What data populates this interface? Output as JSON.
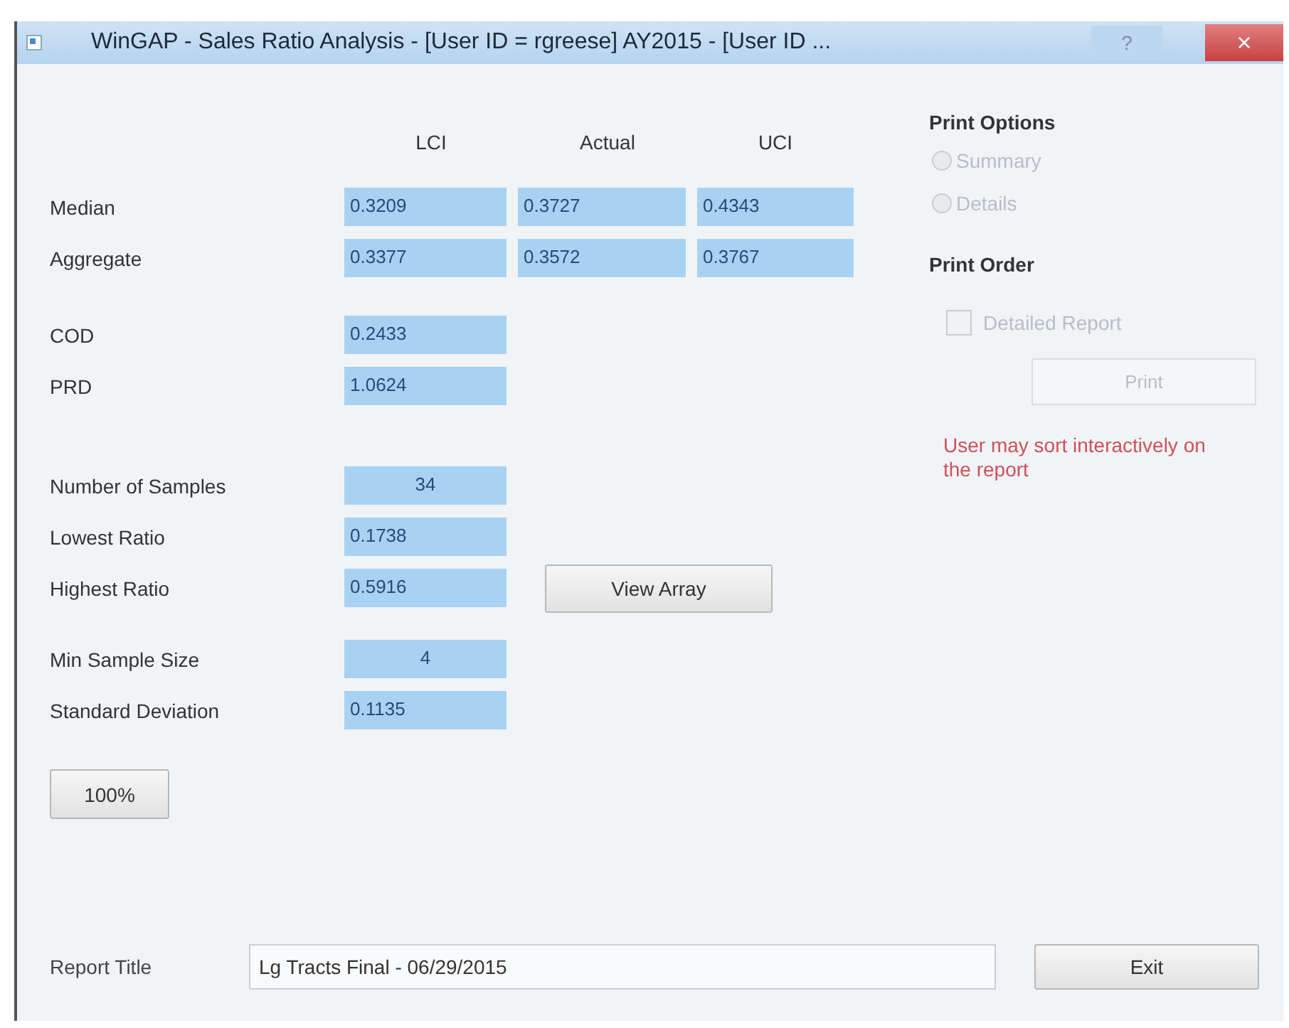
{
  "window": {
    "title": "WinGAP - Sales Ratio Analysis - [User ID = rgreese] AY2015 - [User ID ...",
    "help": "?",
    "close": "×"
  },
  "stats": {
    "columns": [
      "LCI",
      "Actual",
      "UCI"
    ],
    "groups": [
      {
        "rows": [
          {
            "label": "Median",
            "values": [
              "0.3209",
              "0.3727",
              "0.4343"
            ],
            "kind": "decimal"
          },
          {
            "label": "Aggregate",
            "values": [
              "0.3377",
              "0.3572",
              "0.3767"
            ],
            "kind": "decimal"
          }
        ]
      },
      {
        "rows": [
          {
            "label": "COD",
            "values": [
              "0.2433"
            ],
            "kind": "decimal"
          },
          {
            "label": "PRD",
            "values": [
              "1.0624"
            ],
            "kind": "decimal"
          }
        ]
      },
      {
        "rows": [
          {
            "label": "Number of Samples",
            "values": [
              "34"
            ],
            "kind": "integer"
          },
          {
            "label": "Lowest Ratio",
            "values": [
              "0.1738"
            ],
            "kind": "decimal"
          },
          {
            "label": "Highest Ratio",
            "values": [
              "0.5916"
            ],
            "kind": "decimal",
            "button": "View Array"
          }
        ]
      },
      {
        "rows": [
          {
            "label": "Min Sample Size",
            "values": [
              "4"
            ],
            "kind": "integer"
          },
          {
            "label": "Standard Deviation",
            "values": [
              "0.1135"
            ],
            "kind": "decimal"
          }
        ]
      }
    ]
  },
  "percent_button": "100%",
  "print_options": {
    "heading": "Print Options",
    "radios": [
      {
        "label": "Summary",
        "selected": false,
        "disabled": true
      },
      {
        "label": "Details",
        "selected": false,
        "disabled": true
      }
    ]
  },
  "print_order": {
    "heading": "Print Order",
    "checkbox": {
      "label": "Detailed Report",
      "checked": false,
      "disabled": true
    },
    "print_button": {
      "label": "Print",
      "disabled": true
    },
    "note": "User may sort interactively on the report"
  },
  "report_title": {
    "label": "Report Title",
    "value": "Lg Tracts Final - 06/29/2015"
  },
  "exit_button": "Exit"
}
